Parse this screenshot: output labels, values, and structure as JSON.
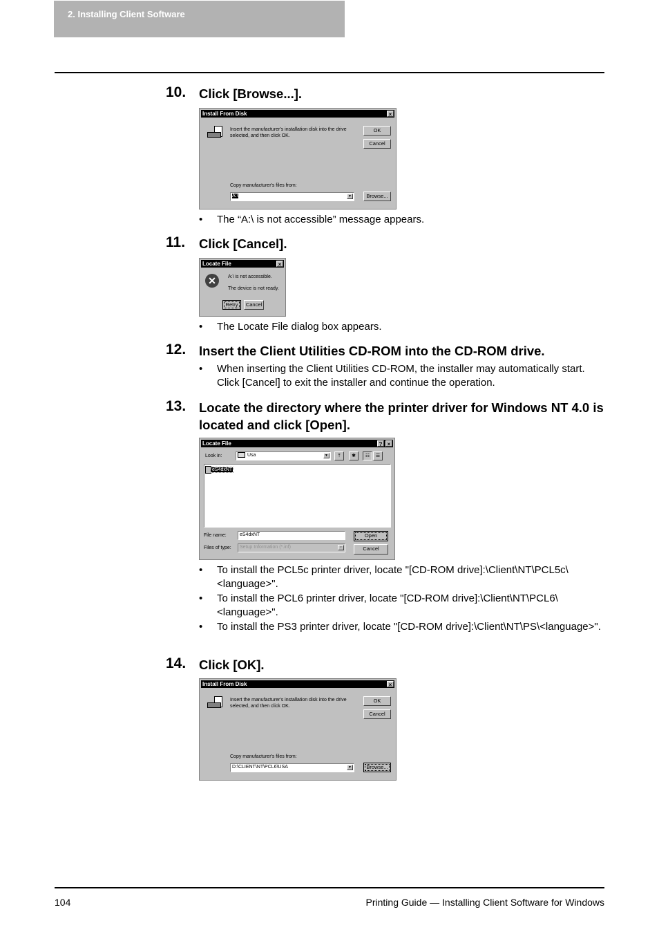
{
  "header": {
    "section": "2. Installing Client Software"
  },
  "steps": [
    {
      "num": "10.",
      "title": "Click [Browse...].",
      "bullets": [
        "The “A:\\ is not accessible” message appears."
      ]
    },
    {
      "num": "11.",
      "title": "Click [Cancel].",
      "bullets": [
        "The Locate File dialog box appears."
      ]
    },
    {
      "num": "12.",
      "title": "Insert the Client Utilities CD-ROM into the CD-ROM drive.",
      "bullets": [
        "When inserting the Client Utilities CD-ROM, the installer may automatically start. Click [Cancel] to exit the installer and continue the operation."
      ]
    },
    {
      "num": "13.",
      "title": "Locate the directory where the printer driver for Windows NT 4.0 is located and click [Open].",
      "bullets": [
        "To install the PCL5c printer driver, locate \"[CD-ROM drive]:\\Client\\NT\\PCL5c\\<language>\".",
        "To install the PCL6 printer driver, locate \"[CD-ROM drive]:\\Client\\NT\\PCL6\\<language>\".",
        "To install the PS3 printer driver, locate \"[CD-ROM drive]:\\Client\\NT\\PS\\<language>\"."
      ]
    },
    {
      "num": "14.",
      "title": "Click [OK].",
      "bullets": []
    }
  ],
  "dialogs": {
    "install1": {
      "title": "Install From Disk",
      "message": "Insert the manufacturer's installation disk into the drive selected, and then click OK.",
      "ok": "OK",
      "cancel": "Cancel",
      "copy_label": "Copy manufacturer's files from:",
      "path": "A:\\",
      "browse": "Browse..."
    },
    "error": {
      "title": "Locate File",
      "line1": "A:\\ is not accessible.",
      "line2": "The device is not ready.",
      "retry": "Retry",
      "cancel": "Cancel"
    },
    "locate": {
      "title": "Locate File",
      "look_in_label": "Look in:",
      "look_in_value": "Usa",
      "file_item": "eS4dxNT",
      "file_name_label": "File name:",
      "file_name_value": "eS4dxNT",
      "files_type_label": "Files of type:",
      "files_type_value": "Setup Information (*.inf)",
      "open": "Open",
      "cancel": "Cancel"
    },
    "install2": {
      "title": "Install From Disk",
      "message": "Insert the manufacturer's installation disk into the drive selected, and then click OK.",
      "ok": "OK",
      "cancel": "Cancel",
      "copy_label": "Copy manufacturer's files from:",
      "path": "D:\\CLIENT\\NT\\PCL6\\USA",
      "browse": "Browse..."
    }
  },
  "bullet_char": "•",
  "footer": {
    "page": "104",
    "title": "Printing Guide — Installing Client Software for Windows"
  }
}
